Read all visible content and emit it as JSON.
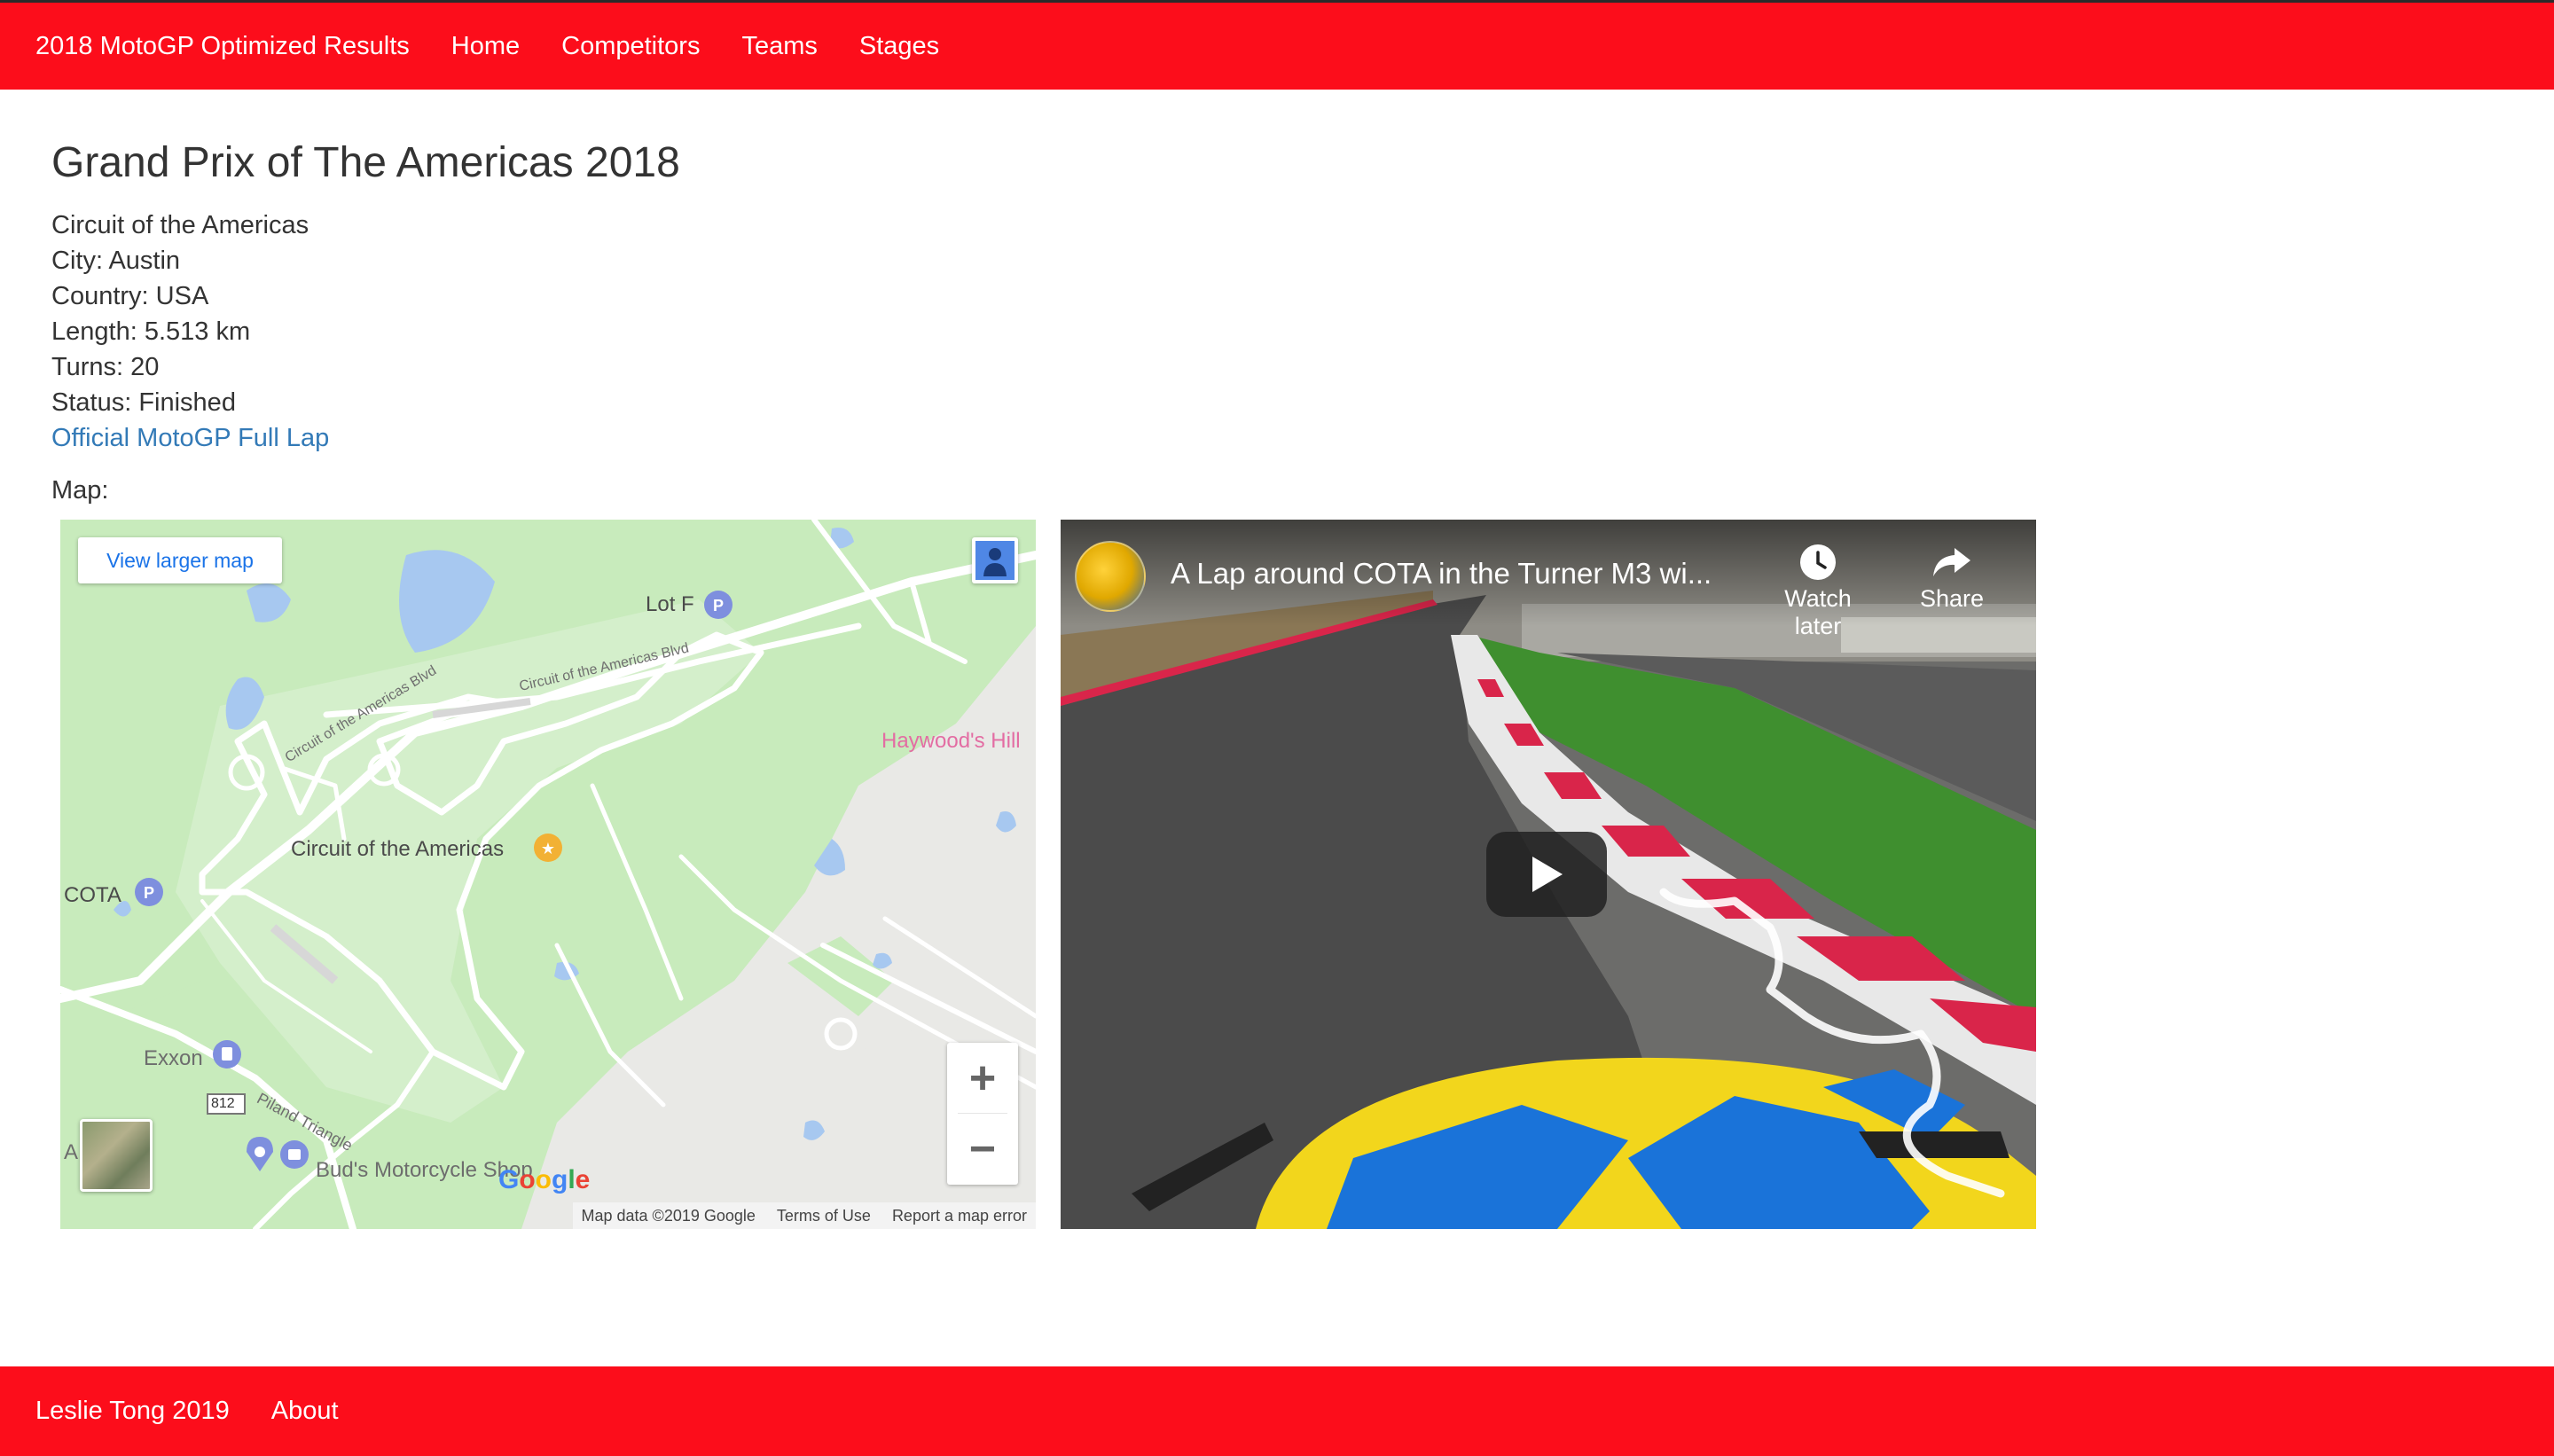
{
  "navbar": {
    "brand": "2018 MotoGP Optimized Results",
    "links": [
      "Home",
      "Competitors",
      "Teams",
      "Stages"
    ]
  },
  "page": {
    "title": "Grand Prix of The Americas 2018",
    "circuit": "Circuit of the Americas",
    "city": "City: Austin",
    "country": "Country: USA",
    "length": "Length: 5.513 km",
    "turns": "Turns: 20",
    "status": "Status: Finished",
    "lap_link": "Official MotoGP Full Lap",
    "map_label": "Map:"
  },
  "map": {
    "view_larger": "View larger map",
    "labels": {
      "lot_f": "Lot F",
      "haywoods_hill": "Haywood's Hill",
      "circuit": "Circuit of the Americas",
      "cota": "COTA",
      "exxon": "Exxon",
      "road_812": "812",
      "piland_triangle": "Piland Triangle",
      "demolition": "A    nolition",
      "buds": "Bud's Motorcycle Shop",
      "blvd_1": "Circuit of the Americas Blvd",
      "blvd_2": "Circuit of the Americas Blvd"
    },
    "zoom_in": "+",
    "zoom_out": "−",
    "google": [
      "G",
      "o",
      "o",
      "g",
      "l",
      "e"
    ],
    "attribution": [
      "Map data ©2019 Google",
      "Terms of Use",
      "Report a map error"
    ],
    "colors": {
      "park": "#c8ebbc",
      "water": "#a7c8f0",
      "road": "#ffffff",
      "pin": "#7e8fde",
      "star_pin": "#f2b134"
    }
  },
  "video": {
    "title": "A Lap around COTA in the Turner M3 wi...",
    "watch_later": "Watch later",
    "share": "Share",
    "icons": [
      "clock-icon",
      "share-arrow-icon",
      "play-icon"
    ]
  },
  "footer": {
    "copyright": "Leslie Tong 2019",
    "about": "About"
  },
  "colors": {
    "brand_red": "#fc0d1b",
    "link_blue": "#337ab7"
  }
}
